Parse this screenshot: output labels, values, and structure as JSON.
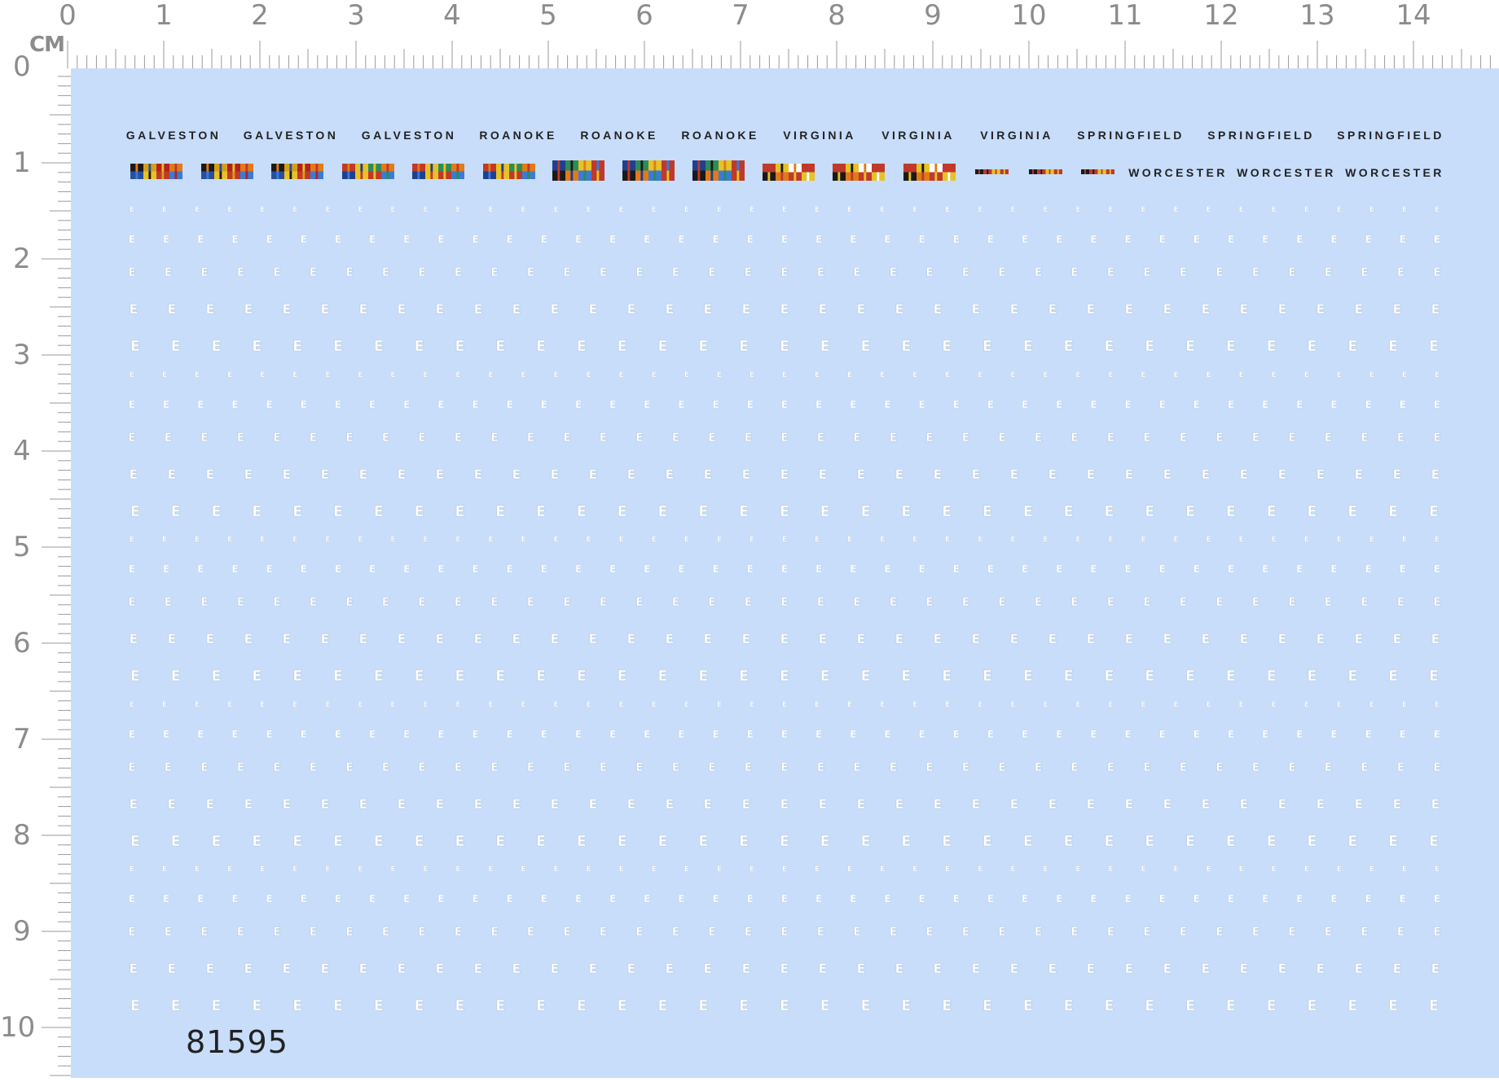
{
  "ruler": {
    "unit_label": "CM",
    "top_numbers": [
      "0",
      "1",
      "2",
      "3",
      "4",
      "5",
      "6",
      "7",
      "8",
      "9",
      "10",
      "11",
      "12",
      "13",
      "14"
    ],
    "left_numbers": [
      "0",
      "1",
      "2",
      "3",
      "4",
      "5",
      "6",
      "7",
      "8",
      "9",
      "10"
    ]
  },
  "ship_names_row1": [
    "GALVESTON",
    "GALVESTON",
    "GALVESTON",
    "ROANOKE",
    "ROANOKE",
    "ROANOKE",
    "VIRGINIA",
    "VIRGINIA",
    "VIRGINIA",
    "SPRINGFIELD",
    "SPRINGFIELD",
    "SPRINGFIELD"
  ],
  "ship_names_row2": [
    "WORCESTER",
    "WORCESTER",
    "WORCESTER"
  ],
  "ribbon_bars": [
    {
      "group": "galveston",
      "colors": [
        "#1a1a1a",
        "#d4a017",
        "#b22222",
        "#e07b1a",
        "#2a4fa0",
        "#e6c229",
        "#c0392b",
        "#3a7bd5"
      ]
    },
    {
      "group": "galveston",
      "colors": [
        "#1a1a1a",
        "#d4a017",
        "#b22222",
        "#e07b1a",
        "#2a4fa0",
        "#e6c229",
        "#c0392b",
        "#3a7bd5"
      ]
    },
    {
      "group": "galveston",
      "colors": [
        "#1a1a1a",
        "#d4a017",
        "#b22222",
        "#e07b1a",
        "#2a4fa0",
        "#e6c229",
        "#c0392b",
        "#3a7bd5"
      ]
    },
    {
      "group": "roanoke",
      "colors": [
        "#c0392b",
        "#e6c229",
        "#2e8b57",
        "#e07b1a",
        "#1f3f8f",
        "#e6c229",
        "#c0392b",
        "#3a7bd5"
      ]
    },
    {
      "group": "roanoke",
      "colors": [
        "#c0392b",
        "#e6c229",
        "#2e8b57",
        "#e07b1a",
        "#1f3f8f",
        "#e6c229",
        "#c0392b",
        "#3a7bd5"
      ]
    },
    {
      "group": "roanoke",
      "colors": [
        "#c0392b",
        "#e6c229",
        "#2e8b57",
        "#e07b1a",
        "#1f3f8f",
        "#e6c229",
        "#c0392b",
        "#3a7bd5"
      ]
    },
    {
      "group": "virginia-a",
      "colors": [
        "#1f3f8f",
        "#2e8b57",
        "#e6c229",
        "#c0392b",
        "#1a1a1a",
        "#e07b1a",
        "#3a7bd5",
        "#c0392b"
      ]
    },
    {
      "group": "virginia-a",
      "colors": [
        "#1f3f8f",
        "#2e8b57",
        "#e6c229",
        "#c0392b",
        "#1a1a1a",
        "#e07b1a",
        "#3a7bd5",
        "#c0392b"
      ]
    },
    {
      "group": "virginia-a",
      "colors": [
        "#1f3f8f",
        "#2e8b57",
        "#e6c229",
        "#c0392b",
        "#1a1a1a",
        "#e07b1a",
        "#3a7bd5",
        "#c0392b"
      ]
    },
    {
      "group": "virginia-b",
      "colors": [
        "#c0392b",
        "#e6c229",
        "#ffffff",
        "#c0392b",
        "#1a1a1a",
        "#e07b1a",
        "#c0392b",
        "#e6c229"
      ]
    },
    {
      "group": "virginia-b",
      "colors": [
        "#c0392b",
        "#e6c229",
        "#ffffff",
        "#c0392b",
        "#1a1a1a",
        "#e07b1a",
        "#c0392b",
        "#e6c229"
      ]
    },
    {
      "group": "virginia-b",
      "colors": [
        "#c0392b",
        "#e6c229",
        "#ffffff",
        "#c0392b",
        "#1a1a1a",
        "#e07b1a",
        "#c0392b",
        "#e6c229"
      ]
    },
    {
      "group": "small",
      "colors": [
        "#1a1a1a",
        "#c0392b",
        "#e6c229",
        "#c0392b"
      ]
    },
    {
      "group": "small",
      "colors": [
        "#1a1a1a",
        "#c0392b",
        "#e6c229",
        "#c0392b"
      ]
    },
    {
      "group": "small",
      "colors": [
        "#1a1a1a",
        "#c0392b",
        "#e6c229",
        "#c0392b"
      ]
    }
  ],
  "decal_glyph": "E",
  "catalog_number": "81595",
  "colors": {
    "sheet_background": "#c7ddfa",
    "ruler_text": "#8c8c8c",
    "decal_white": "#ffffff",
    "text_dark": "#222222"
  }
}
